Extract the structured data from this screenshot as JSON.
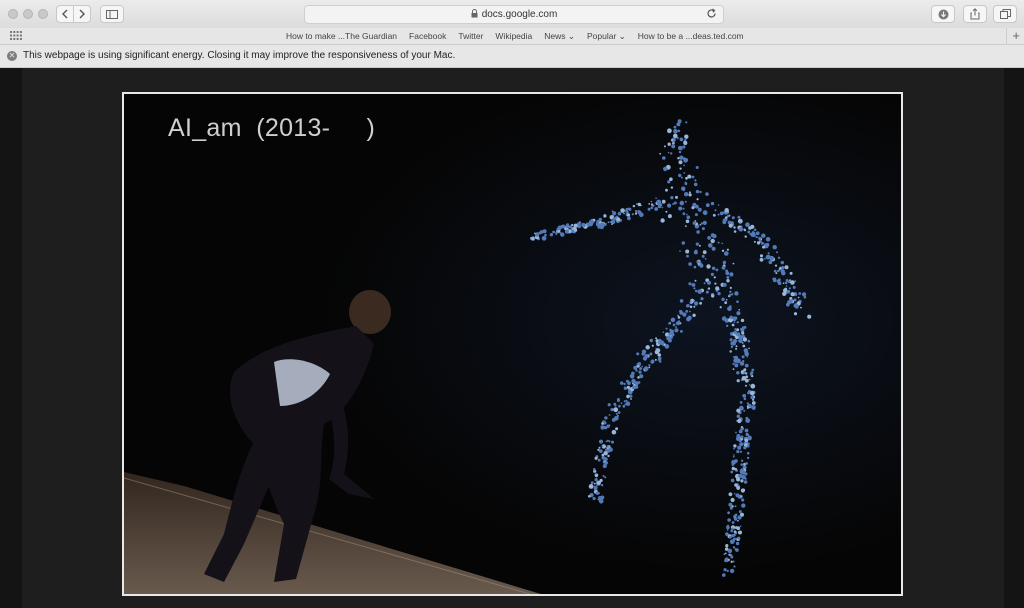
{
  "browser": {
    "url": "docs.google.com",
    "bookmarks": [
      "How to make ...The Guardian",
      "Facebook",
      "Twitter",
      "Wikipedia",
      "News ⌄",
      "Popular ⌄",
      "How to be a ...deas.ted.com"
    ],
    "new_tab_label": "+"
  },
  "notification": {
    "message": "This webpage is using significant energy. Closing it may improve the responsiveness of your Mac."
  },
  "slide": {
    "title": "AI_am  (2013-     )"
  },
  "icons": {
    "back": "chevron-left-icon",
    "forward": "chevron-right-icon",
    "sidebar": "sidebar-icon",
    "lock": "lock-icon",
    "reload": "reload-icon",
    "download": "download-icon",
    "share": "share-icon",
    "tabs": "tabs-icon",
    "grid": "grid-icon",
    "close": "close-icon"
  },
  "colors": {
    "particle_figure": "#5c86c8",
    "slide_background": "#050505",
    "slide_border": "#e8e8e8"
  }
}
